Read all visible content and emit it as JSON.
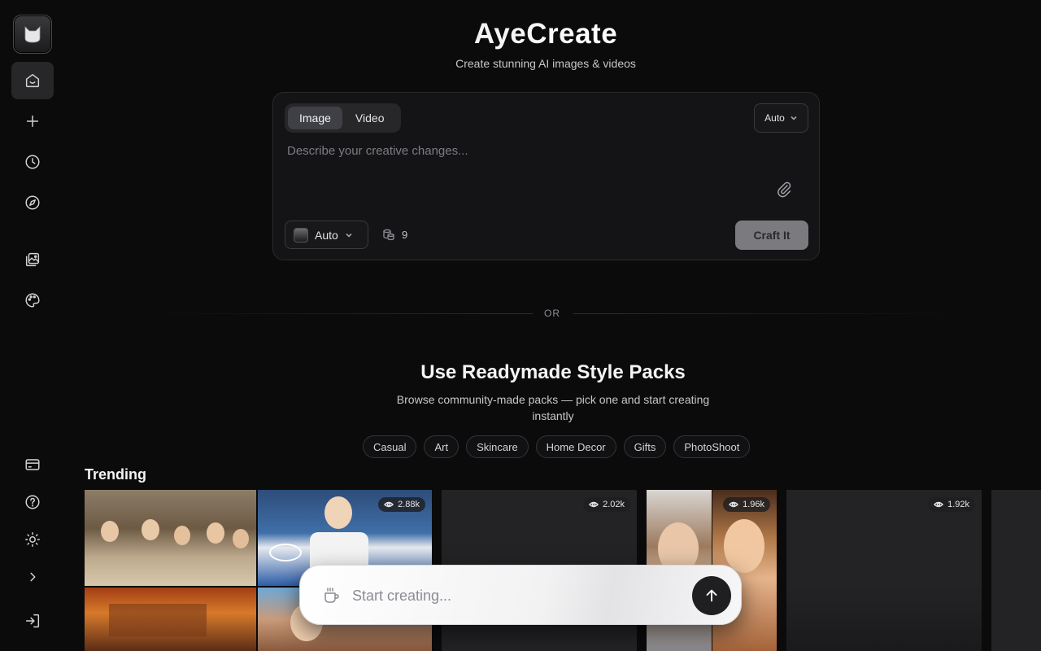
{
  "app": {
    "title": "AyeCreate",
    "subtitle": "Create stunning AI images & videos"
  },
  "sidebar": {
    "items": [
      {
        "icon": "home-icon",
        "active": true
      },
      {
        "icon": "plus-icon"
      },
      {
        "icon": "clock-icon"
      },
      {
        "icon": "compass-icon"
      },
      {
        "icon": "gallery-icon"
      },
      {
        "icon": "palette-icon"
      },
      {
        "icon": "credit-card-icon"
      },
      {
        "icon": "help-icon"
      },
      {
        "icon": "sun-icon"
      },
      {
        "icon": "chevron-right-icon"
      },
      {
        "icon": "login-icon"
      }
    ]
  },
  "composer": {
    "modes": [
      "Image",
      "Video"
    ],
    "active_mode": "Image",
    "ratio": "Auto",
    "prompt_placeholder": "Describe your creative changes...",
    "model": "Auto",
    "credits": "9",
    "submit_label": "Craft It"
  },
  "divider_label": "OR",
  "style_packs": {
    "title": "Use Readymade Style Packs",
    "subtitle": "Browse community-made packs — pick one and start creating instantly",
    "categories": [
      "Casual",
      "Art",
      "Skincare",
      "Home Decor",
      "Gifts",
      "PhotoShoot"
    ]
  },
  "trending": {
    "title": "Trending",
    "cards": [
      {
        "views": "2.88k"
      },
      {
        "views": "2.02k"
      },
      {
        "views": "1.96k"
      },
      {
        "views": "1.92k"
      }
    ]
  },
  "quick_prompt": {
    "placeholder": "Start creating..."
  },
  "colors": {
    "background": "#0b0b0c",
    "card": "#141416",
    "accent_button": "#7a7a7f"
  }
}
